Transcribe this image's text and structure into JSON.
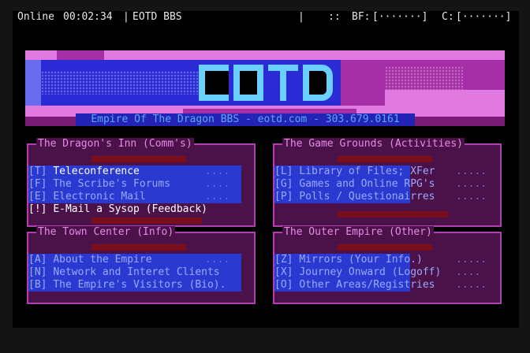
{
  "status": {
    "online_label": "Online",
    "timer": "00:02:34",
    "board_name": "EOTD BBS",
    "sep1": "|",
    "sep2": "|",
    "buffer_label": "BF:",
    "buffer_value": "[·······]",
    "capture_label": "C:",
    "capture_value": "[·······]",
    "marker": "::"
  },
  "banner": {
    "tagline": "Empire Of The Dragon BBS - eotd.com - 303.679.0161"
  },
  "panels": [
    {
      "title": "The Dragon's Inn (Comm's)",
      "items": [
        {
          "key": "[T]",
          "label": "Teleconference",
          "dots": "...."
        },
        {
          "key": "[F]",
          "label": "The Scribe's Forums",
          "dots": "...."
        },
        {
          "key": "[E]",
          "label": "Electronic Mail",
          "dots": "...."
        },
        {
          "key": "[!]",
          "label": "E-Mail a Sysop (Feedback)",
          "dots": ""
        }
      ]
    },
    {
      "title": "The Game Grounds (Activities)",
      "items": [
        {
          "key": "[L]",
          "label": "Library of Files; XFer",
          "dots": "....."
        },
        {
          "key": "[G]",
          "label": "Games and Online RPG's",
          "dots": "....."
        },
        {
          "key": "[P]",
          "label": "Polls / Questionairres",
          "dots": "....."
        }
      ]
    },
    {
      "title": "The Town Center (Info)",
      "items": [
        {
          "key": "[A]",
          "label": "About the Empire",
          "dots": "...."
        },
        {
          "key": "[N]",
          "label": "Network and Interet Clients",
          "dots": ""
        },
        {
          "key": "[B]",
          "label": "The Empire's Visitors (Bio).",
          "dots": ""
        }
      ]
    },
    {
      "title": "The Outer Empire (Other)",
      "items": [
        {
          "key": "[Z]",
          "label": "Mirrors (Your Info.)",
          "dots": "....."
        },
        {
          "key": "[X]",
          "label": "Journey Onward (Logoff)",
          "dots": "...."
        },
        {
          "key": "[O]",
          "label": "Other Areas/Registries",
          "dots": "....."
        }
      ]
    }
  ]
}
